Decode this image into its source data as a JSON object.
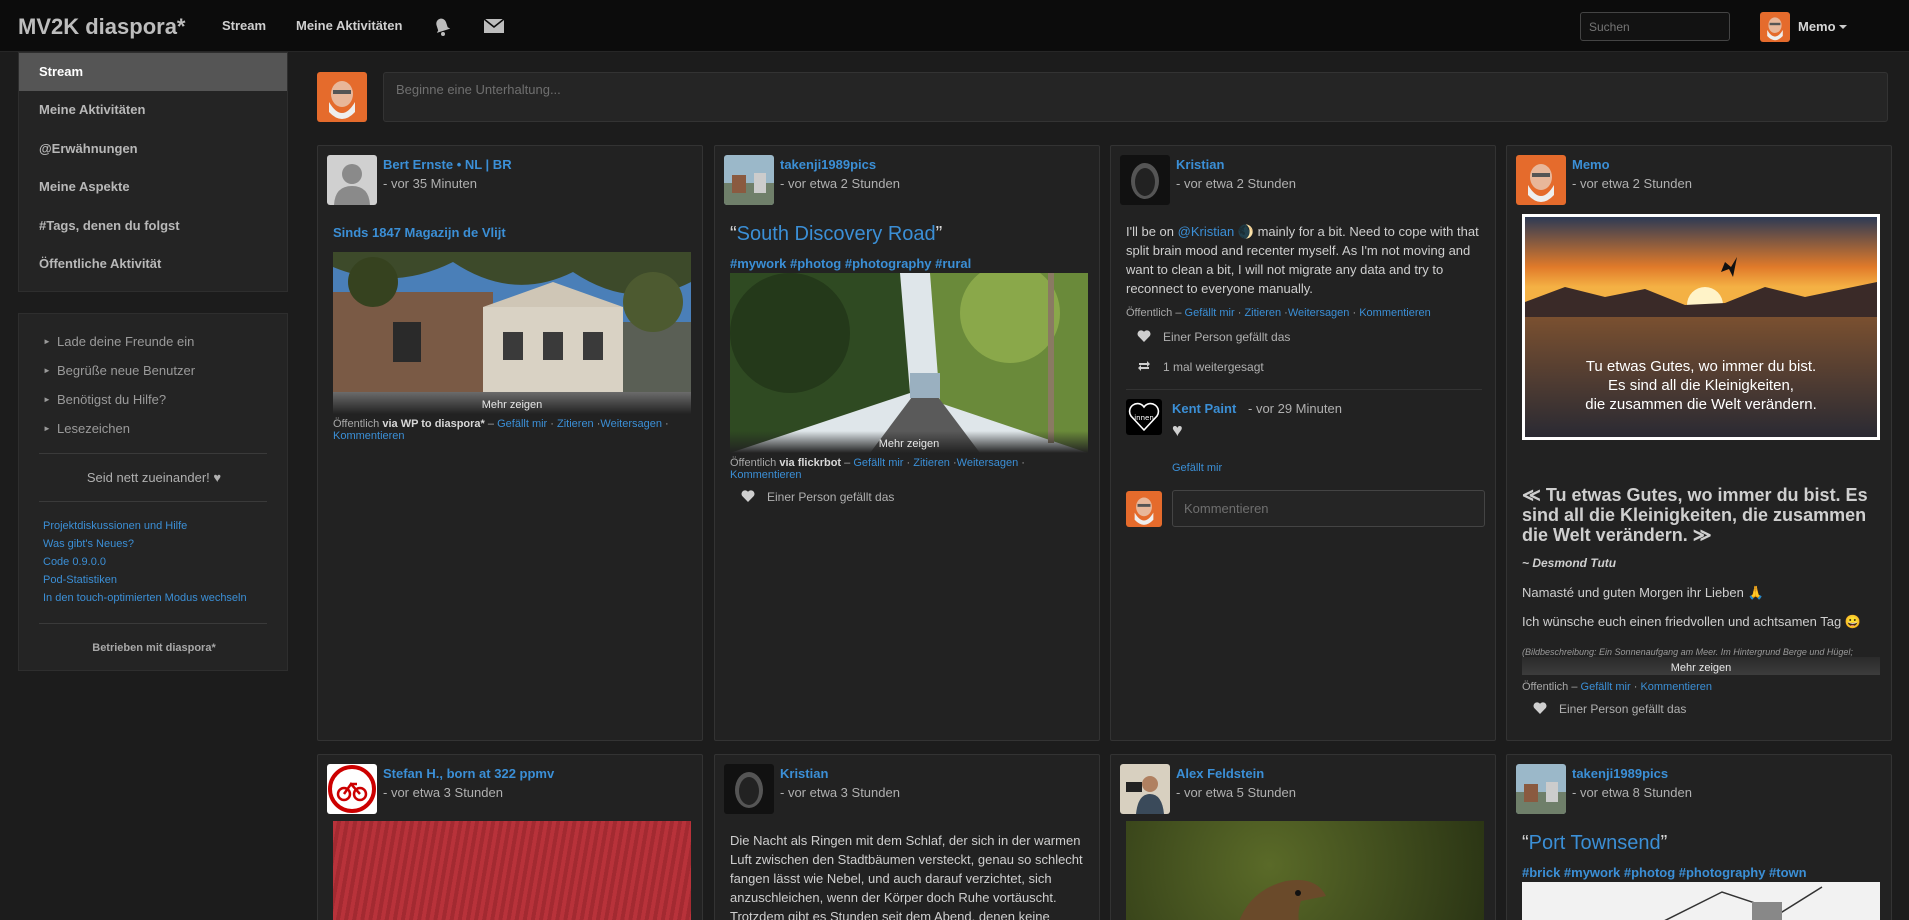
{
  "header": {
    "brand": "MV2K diaspora*",
    "nav": [
      "Stream",
      "Meine Aktivitäten"
    ],
    "search_placeholder": "Suchen",
    "user": "Memo"
  },
  "sidebar": {
    "items": [
      "Stream",
      "Meine Aktivitäten",
      "@Erwähnungen",
      "Meine Aspekte",
      "#Tags, denen du folgst",
      "Öffentliche Aktivität"
    ],
    "actions": [
      "Lade deine Freunde ein",
      "Begrüße neue Benutzer",
      "Benötigst du Hilfe?",
      "Lesezeichen"
    ],
    "nice": "Seid nett zueinander! ♥",
    "links": [
      "Projektdiskussionen und Hilfe",
      "Was gibt's Neues?",
      "Code 0.9.0.0",
      "Pod-Statistiken",
      "In den touch-optimierten Modus wechseln"
    ],
    "powered": "Betrieben mit diaspora*"
  },
  "publisher": {
    "placeholder": "Beginne eine Unterhaltung..."
  },
  "common": {
    "public": "Öffentlich",
    "dash": "–",
    "like": "Gefällt mir",
    "quote": "Zitieren",
    "reshare": "Weitersagen",
    "comment": "Kommentieren",
    "show_more": "Mehr zeigen",
    "one_like": "Einer Person gefällt das"
  },
  "posts": [
    {
      "author": "Bert Ernste • NL | BR",
      "time": "- vor 35 Minuten",
      "link": "Sinds 1847 Magazijn de Vlijt",
      "via": "via WP to diaspora*"
    },
    {
      "author": "takenji1989pics",
      "time": "- vor etwa 2 Stunden",
      "title_open": "“",
      "title": "South Discovery Road",
      "title_close": "”",
      "tags": "#mywork #photog #photography #rural",
      "via": "via flickrbot"
    },
    {
      "author": "Kristian",
      "time": "- vor etwa 2 Stunden",
      "text_a": "I'll be on ",
      "mention": "@Kristian",
      "text_b": " 🌒 mainly for a bit. Need to cope with that split brain mood and recenter myself. As I'm not moving and want to clean a bit, I will not migrate any data and try to reconnect to everyone manually.",
      "reshared": "1 mal weitergesagt",
      "comment_author": "Kent Paint",
      "comment_time": "- vor 29 Minuten",
      "comment_text": "♥",
      "comment_badge": "innen",
      "comment_like": "Gefällt mir",
      "comment_placeholder": "Kommentieren"
    },
    {
      "author": "Memo",
      "time": "- vor etwa 2 Stunden",
      "img_line1": "Tu etwas Gutes, wo immer du bist.",
      "img_line2": "Es sind all die Kleinigkeiten,",
      "img_line3": "die zusammen die Welt verändern.",
      "quote": "≪ Tu etwas Gutes, wo immer du bist. Es sind all die Kleinigkeiten, die zusammen die Welt verändern. ≫",
      "quote_author": "~ Desmond Tutu",
      "greeting": "Namasté und guten Morgen ihr Lieben 🙏",
      "wish": "Ich wünsche euch einen friedvollen und achtsamen Tag 😀",
      "desc": "(Bildbeschreibung: Ein Sonnenaufgang am Meer. Im Hintergrund Berge und Hügel;"
    },
    {
      "author": "Stefan H., born at 322 ppmv",
      "time": "- vor etwa 3 Stunden"
    },
    {
      "author": "Kristian",
      "time": "- vor etwa 3 Stunden",
      "text": "Die Nacht als Ringen mit dem Schlaf, der sich in der warmen Luft zwischen den Stadtbäumen versteckt, genau so schlecht fangen lässt wie Nebel, und auch darauf verzichtet, sich anzuschleichen, wenn der Körper doch Ruhe vortäuscht. Trotzdem gibt es Stunden seit dem Abend, denen keine"
    },
    {
      "author": "Alex Feldstein",
      "time": "- vor etwa 5 Stunden"
    },
    {
      "author": "takenji1989pics",
      "time": "- vor etwa 8 Stunden",
      "title_open": "“",
      "title": "Port Townsend",
      "title_close": "”",
      "tags": "#brick #mywork #photog #photography #town"
    }
  ]
}
